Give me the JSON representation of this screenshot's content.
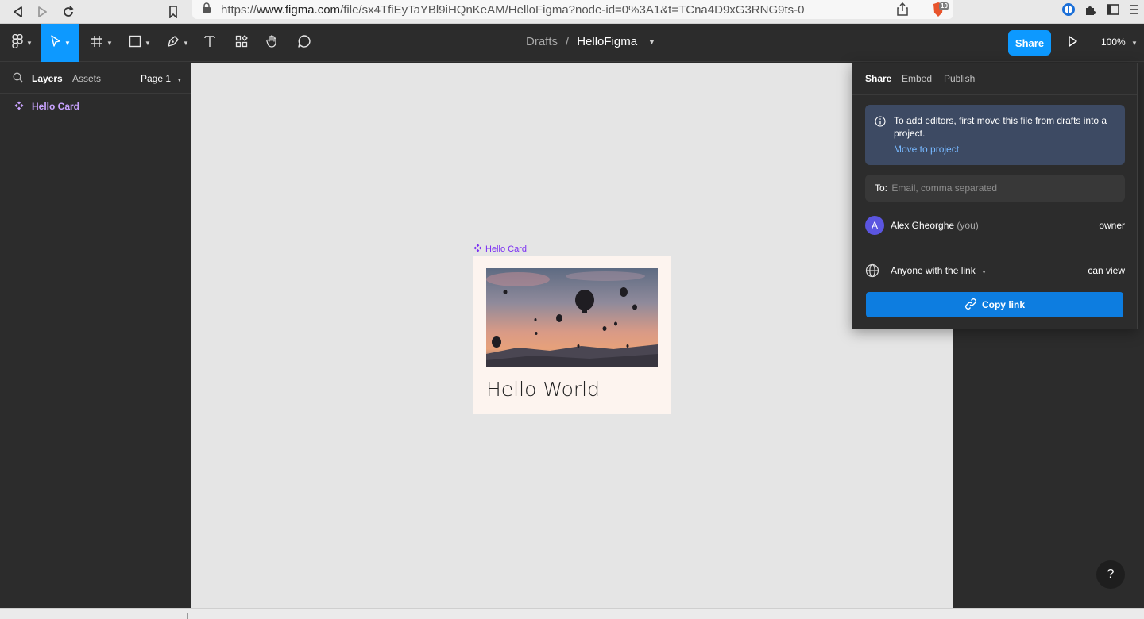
{
  "browser": {
    "url_scheme": "https://",
    "url_host": "www.figma.com",
    "url_path": "/file/sx4TfiEyTaYBl9iHQnKeAM/HelloFigma?node-id=0%3A1&t=TCna4D9xG3RNG9ts-0",
    "brave_badge": "10"
  },
  "toolbar": {
    "breadcrumb_parent": "Drafts",
    "breadcrumb_sep": "/",
    "file_name": "HelloFigma",
    "share_label": "Share",
    "zoom_label": "100%"
  },
  "left_panel": {
    "tab_layers": "Layers",
    "tab_assets": "Assets",
    "page_label": "Page 1",
    "layers": [
      {
        "label": "Hello Card"
      }
    ]
  },
  "canvas": {
    "frame_label": "Hello Card",
    "card_title": "Hello World"
  },
  "share_popover": {
    "tabs": [
      "Share",
      "Embed",
      "Publish"
    ],
    "info_message": "To add editors, first move this file from drafts into a project.",
    "info_link": "Move to project",
    "email_prefix": "To:",
    "email_placeholder": "Email, comma separated",
    "user_initial": "A",
    "user_name": "Alex Gheorghe",
    "user_suffix": "(you)",
    "user_role": "owner",
    "link_audience": "Anyone with the link",
    "link_permission": "can view",
    "copy_link_label": "Copy link"
  },
  "help_label": "?",
  "colors": {
    "accent": "#0d99ff",
    "component": "#7b2ff2",
    "info_bg": "#3d4a63"
  }
}
